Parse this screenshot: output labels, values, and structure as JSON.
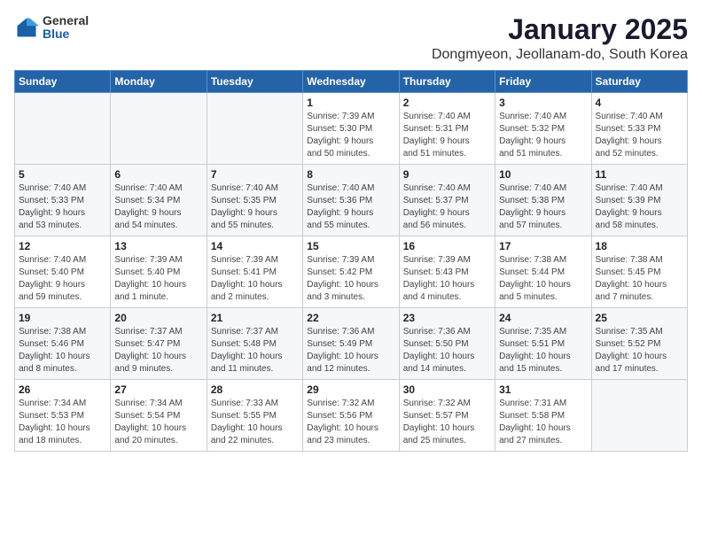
{
  "logo": {
    "general": "General",
    "blue": "Blue"
  },
  "header": {
    "title": "January 2025",
    "subtitle": "Dongmyeon, Jeollanam-do, South Korea"
  },
  "weekdays": [
    "Sunday",
    "Monday",
    "Tuesday",
    "Wednesday",
    "Thursday",
    "Friday",
    "Saturday"
  ],
  "weeks": [
    [
      {
        "day": "",
        "info": ""
      },
      {
        "day": "",
        "info": ""
      },
      {
        "day": "",
        "info": ""
      },
      {
        "day": "1",
        "info": "Sunrise: 7:39 AM\nSunset: 5:30 PM\nDaylight: 9 hours\nand 50 minutes."
      },
      {
        "day": "2",
        "info": "Sunrise: 7:40 AM\nSunset: 5:31 PM\nDaylight: 9 hours\nand 51 minutes."
      },
      {
        "day": "3",
        "info": "Sunrise: 7:40 AM\nSunset: 5:32 PM\nDaylight: 9 hours\nand 51 minutes."
      },
      {
        "day": "4",
        "info": "Sunrise: 7:40 AM\nSunset: 5:33 PM\nDaylight: 9 hours\nand 52 minutes."
      }
    ],
    [
      {
        "day": "5",
        "info": "Sunrise: 7:40 AM\nSunset: 5:33 PM\nDaylight: 9 hours\nand 53 minutes."
      },
      {
        "day": "6",
        "info": "Sunrise: 7:40 AM\nSunset: 5:34 PM\nDaylight: 9 hours\nand 54 minutes."
      },
      {
        "day": "7",
        "info": "Sunrise: 7:40 AM\nSunset: 5:35 PM\nDaylight: 9 hours\nand 55 minutes."
      },
      {
        "day": "8",
        "info": "Sunrise: 7:40 AM\nSunset: 5:36 PM\nDaylight: 9 hours\nand 55 minutes."
      },
      {
        "day": "9",
        "info": "Sunrise: 7:40 AM\nSunset: 5:37 PM\nDaylight: 9 hours\nand 56 minutes."
      },
      {
        "day": "10",
        "info": "Sunrise: 7:40 AM\nSunset: 5:38 PM\nDaylight: 9 hours\nand 57 minutes."
      },
      {
        "day": "11",
        "info": "Sunrise: 7:40 AM\nSunset: 5:39 PM\nDaylight: 9 hours\nand 58 minutes."
      }
    ],
    [
      {
        "day": "12",
        "info": "Sunrise: 7:40 AM\nSunset: 5:40 PM\nDaylight: 9 hours\nand 59 minutes."
      },
      {
        "day": "13",
        "info": "Sunrise: 7:39 AM\nSunset: 5:40 PM\nDaylight: 10 hours\nand 1 minute."
      },
      {
        "day": "14",
        "info": "Sunrise: 7:39 AM\nSunset: 5:41 PM\nDaylight: 10 hours\nand 2 minutes."
      },
      {
        "day": "15",
        "info": "Sunrise: 7:39 AM\nSunset: 5:42 PM\nDaylight: 10 hours\nand 3 minutes."
      },
      {
        "day": "16",
        "info": "Sunrise: 7:39 AM\nSunset: 5:43 PM\nDaylight: 10 hours\nand 4 minutes."
      },
      {
        "day": "17",
        "info": "Sunrise: 7:38 AM\nSunset: 5:44 PM\nDaylight: 10 hours\nand 5 minutes."
      },
      {
        "day": "18",
        "info": "Sunrise: 7:38 AM\nSunset: 5:45 PM\nDaylight: 10 hours\nand 7 minutes."
      }
    ],
    [
      {
        "day": "19",
        "info": "Sunrise: 7:38 AM\nSunset: 5:46 PM\nDaylight: 10 hours\nand 8 minutes."
      },
      {
        "day": "20",
        "info": "Sunrise: 7:37 AM\nSunset: 5:47 PM\nDaylight: 10 hours\nand 9 minutes."
      },
      {
        "day": "21",
        "info": "Sunrise: 7:37 AM\nSunset: 5:48 PM\nDaylight: 10 hours\nand 11 minutes."
      },
      {
        "day": "22",
        "info": "Sunrise: 7:36 AM\nSunset: 5:49 PM\nDaylight: 10 hours\nand 12 minutes."
      },
      {
        "day": "23",
        "info": "Sunrise: 7:36 AM\nSunset: 5:50 PM\nDaylight: 10 hours\nand 14 minutes."
      },
      {
        "day": "24",
        "info": "Sunrise: 7:35 AM\nSunset: 5:51 PM\nDaylight: 10 hours\nand 15 minutes."
      },
      {
        "day": "25",
        "info": "Sunrise: 7:35 AM\nSunset: 5:52 PM\nDaylight: 10 hours\nand 17 minutes."
      }
    ],
    [
      {
        "day": "26",
        "info": "Sunrise: 7:34 AM\nSunset: 5:53 PM\nDaylight: 10 hours\nand 18 minutes."
      },
      {
        "day": "27",
        "info": "Sunrise: 7:34 AM\nSunset: 5:54 PM\nDaylight: 10 hours\nand 20 minutes."
      },
      {
        "day": "28",
        "info": "Sunrise: 7:33 AM\nSunset: 5:55 PM\nDaylight: 10 hours\nand 22 minutes."
      },
      {
        "day": "29",
        "info": "Sunrise: 7:32 AM\nSunset: 5:56 PM\nDaylight: 10 hours\nand 23 minutes."
      },
      {
        "day": "30",
        "info": "Sunrise: 7:32 AM\nSunset: 5:57 PM\nDaylight: 10 hours\nand 25 minutes."
      },
      {
        "day": "31",
        "info": "Sunrise: 7:31 AM\nSunset: 5:58 PM\nDaylight: 10 hours\nand 27 minutes."
      },
      {
        "day": "",
        "info": ""
      }
    ]
  ]
}
